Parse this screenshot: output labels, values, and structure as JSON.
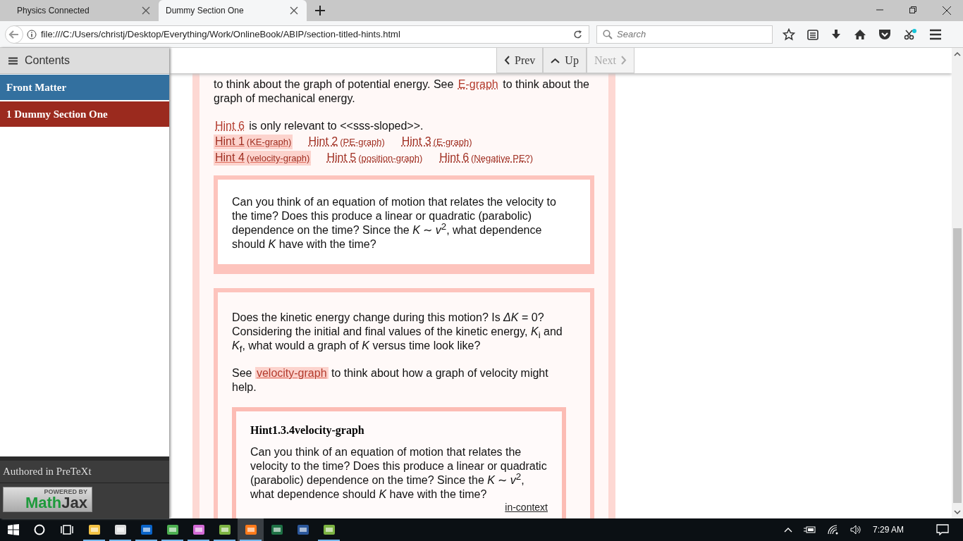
{
  "browser": {
    "tabs": [
      {
        "title": "Physics Connected",
        "selected": false
      },
      {
        "title": "Dummy Section One",
        "selected": true
      }
    ],
    "address": "file:///C:/Users/christj/Desktop/Everything/Work/OnlineBook/ABIP/section-titled-hints.html",
    "search": {
      "placeholder": "Search"
    }
  },
  "sidebar": {
    "toolbar_label": "Contents",
    "items": [
      {
        "label": "Front Matter",
        "selected": false
      },
      {
        "label": "1 Dummy Section One",
        "selected": true
      }
    ],
    "authored": "Authored in PreTeXt",
    "mathjax_badge": {
      "caption": "POWERED BY",
      "name_first": "Math",
      "name_second": "Jax"
    }
  },
  "nav_buttons": [
    {
      "label": "Prev",
      "kind": "prev",
      "disabled": false
    },
    {
      "label": "Up",
      "kind": "up",
      "disabled": false
    },
    {
      "label": "Next",
      "kind": "next",
      "disabled": true
    }
  ],
  "content": {
    "intro": {
      "before": "to think about the graph of potential energy. See",
      "link": "E-graph",
      "after": "to think about the graph of mechanical energy."
    },
    "relevance": {
      "link": "Hint 6",
      "after": "is only relevant to <<sss-sloped>>."
    },
    "hint_rows": [
      {
        "links": [
          {
            "label": "Hint 1",
            "title": "(KE-graph)",
            "expanded": true
          },
          {
            "label": "Hint 2",
            "title": "(PE-graph)",
            "expanded": false
          },
          {
            "label": "Hint 3",
            "title": "(E-graph)",
            "expanded": false
          }
        ]
      },
      {
        "links": [
          {
            "label": "Hint 4",
            "title": "(velocity-graph)",
            "expanded": true
          },
          {
            "label": "Hint 5",
            "title": "(position-graph)",
            "expanded": false
          },
          {
            "label": "Hint 6",
            "title": "(Negative PE?)",
            "expanded": false
          }
        ]
      }
    ],
    "hint_box_1": {
      "text": "Can you think of an equation of motion that relates the velocity to the time? Does this produce a linear or quadratic (parabolic) dependence on the time? Since the *K* ∼ *v*$^{2}$, what dependence should *K* have with the time?"
    },
    "hint_box_2": {
      "text": "Does the kinetic energy change during this motion? Is *ΔK* = 0? Considering the initial and final values of the kinetic energy, *K*$_{i}$ and *K*$_{f}$, what would a graph of *K* versus time look like?",
      "see": {
        "before": "See",
        "link": "velocity-graph",
        "expanded": true,
        "after": "to think about how a graph of velocity might help."
      },
      "nested": {
        "title": "Hint1.3.4velocity-graph",
        "text": "Can you think of an equation of motion that relates the velocity to the time? Does this produce a linear or quadratic (parabolic) dependence on the time? Since the *K* ∼ *v*$^{2}$, what dependence should *K* have with the time?",
        "context_link": "in-context"
      }
    }
  },
  "taskbar": {
    "apps": [
      {
        "running": true,
        "selected": false
      },
      {
        "running": true,
        "selected": false
      },
      {
        "running": true,
        "selected": false
      },
      {
        "running": true,
        "selected": false
      },
      {
        "running": true,
        "selected": false
      },
      {
        "running": true,
        "selected": false
      },
      {
        "running": true,
        "selected": true
      },
      {
        "running": false,
        "selected": false
      },
      {
        "running": false,
        "selected": false
      },
      {
        "running": true,
        "selected": false
      }
    ],
    "clock": "7:29 AM"
  }
}
